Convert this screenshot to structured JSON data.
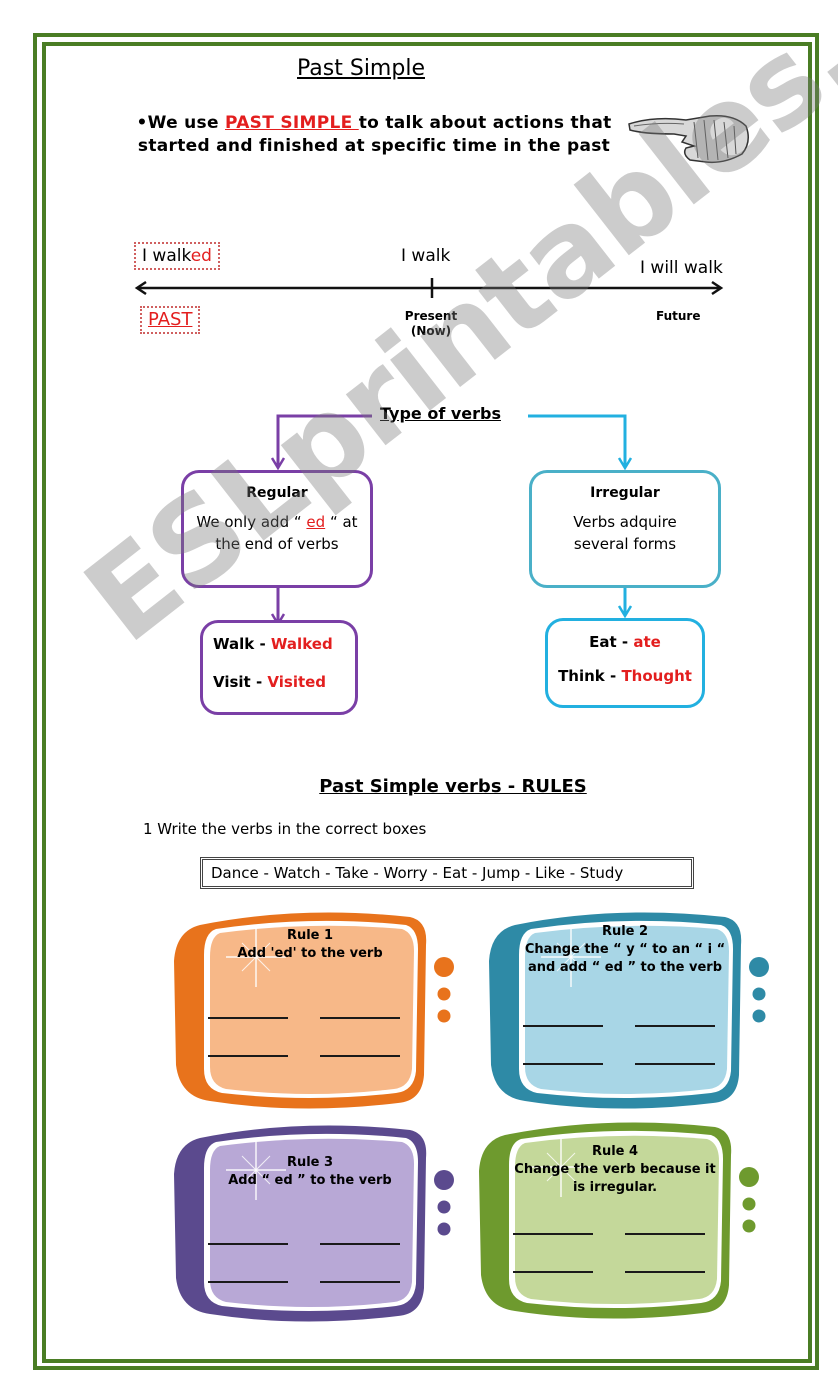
{
  "page": {
    "title": "Past Simple",
    "intro": {
      "bullet": "•We use ",
      "highlight": "PAST SIMPLE ",
      "rest": "to talk about actions that started and finished at specific time in the past"
    },
    "pointing_hand": "pointing-hand-image"
  },
  "timeline": {
    "past_example_base": "I walk",
    "past_example_suffix": "ed",
    "past_label": "PAST",
    "present_example": "I walk",
    "present_label_line1": "Present",
    "present_label_line2": "(Now)",
    "future_example": "I will walk",
    "future_label": "Future"
  },
  "flow": {
    "title": "Type of verbs",
    "regular": {
      "title": "Regular",
      "text_before": "We only add “ ",
      "text_highlight": "ed",
      "text_after": " “ at the end of verbs",
      "examples": [
        {
          "base": "Walk",
          "past": "Walked"
        },
        {
          "base": "Visit",
          "past": "Visited"
        }
      ]
    },
    "irregular": {
      "title": "Irregular",
      "text": "Verbs adquire several forms",
      "examples": [
        {
          "base": "Eat",
          "past": "ate"
        },
        {
          "base": "Think",
          "past": "Thought"
        }
      ]
    },
    "separator": " - "
  },
  "rules": {
    "title": "Past Simple verbs - RULES",
    "instruction": "1 Write the verbs in the correct boxes",
    "word_bank": "Dance - Watch - Take - Worry - Eat - Jump - Like - Study",
    "cards": [
      {
        "title": "Rule 1",
        "text": "Add 'ed' to the verb",
        "color": "#e8731c",
        "fill": "#f7b888"
      },
      {
        "title": "Rule 2",
        "text": "Change the “ y “ to an “ i “ and add “ ed ” to the verb",
        "color": "#2e8aa6",
        "fill": "#a8d6e6"
      },
      {
        "title": "Rule 3",
        "text": "Add “ ed ” to the verb",
        "color": "#5b4a8e",
        "fill": "#b8a8d6"
      },
      {
        "title": "Rule 4",
        "text": "Change the verb because it is irregular.",
        "color": "#6e9a2e",
        "fill": "#c4d89a"
      }
    ]
  },
  "watermark": "ESLprintables.com",
  "colors": {
    "border": "#4a7d24",
    "red": "#e31e1e",
    "regular": "#7a3fa6",
    "irregular_box": "#4ab0c8",
    "irregular_arrow": "#22b0e0"
  }
}
